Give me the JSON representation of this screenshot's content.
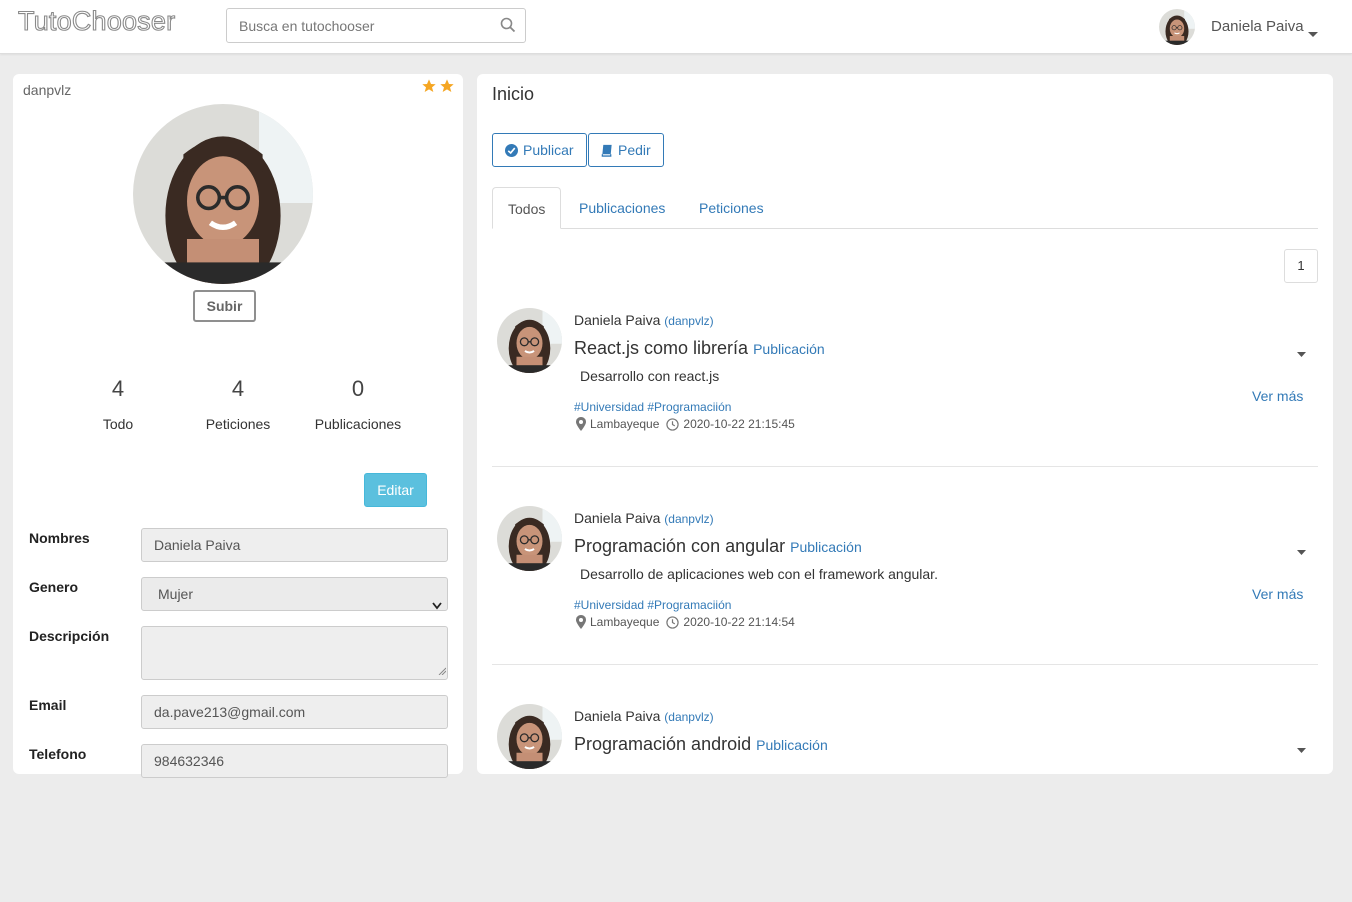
{
  "app": {
    "brand": "TutoChooser"
  },
  "search": {
    "placeholder": "Busca en tutochooser"
  },
  "nav": {
    "user_name": "Daniela Paiva"
  },
  "profile": {
    "username": "danpvlz",
    "stars": 2,
    "upload_label": "Subir",
    "stats": [
      {
        "value": "4",
        "label": "Todo"
      },
      {
        "value": "4",
        "label": "Peticiones"
      },
      {
        "value": "0",
        "label": "Publicaciones"
      }
    ],
    "edit_label": "Editar",
    "fields": {
      "nombres": {
        "label": "Nombres",
        "value": "Daniela Paiva"
      },
      "genero": {
        "label": "Genero",
        "value": "Mujer"
      },
      "descripcion": {
        "label": "Descripción",
        "value": ""
      },
      "email": {
        "label": "Email",
        "value": "da.pave213@gmail.com"
      },
      "telefono": {
        "label": "Telefono",
        "value": "984632346"
      }
    }
  },
  "main": {
    "title": "Inicio",
    "actions": {
      "publish": "Publicar",
      "request": "Pedir"
    },
    "tabs": [
      "Todos",
      "Publicaciones",
      "Peticiones"
    ],
    "page": "1",
    "posts": [
      {
        "author": "Daniela Paiva",
        "handle": "(danpvlz)",
        "title": "React.js como librería",
        "type": "Publicación",
        "description": "Desarrollo con react.js",
        "tags": "#Universidad #Programaciión",
        "location": "Lambayeque",
        "date": "2020-10-22 21:15:45",
        "more": "Ver más"
      },
      {
        "author": "Daniela Paiva",
        "handle": "(danpvlz)",
        "title": "Programación con angular",
        "type": "Publicación",
        "description": "Desarrollo de aplicaciones web con el framework angular.",
        "tags": "#Universidad #Programaciión",
        "location": "Lambayeque",
        "date": "2020-10-22 21:14:54",
        "more": "Ver más"
      },
      {
        "author": "Daniela Paiva",
        "handle": "(danpvlz)",
        "title": "Programación android",
        "type": "Publicación",
        "description": "",
        "tags": "",
        "location": "",
        "date": "",
        "more": ""
      }
    ]
  },
  "colors": {
    "link": "#337ab7",
    "info": "#5bc0de",
    "star": "#f5a623",
    "background": "#ececec"
  }
}
